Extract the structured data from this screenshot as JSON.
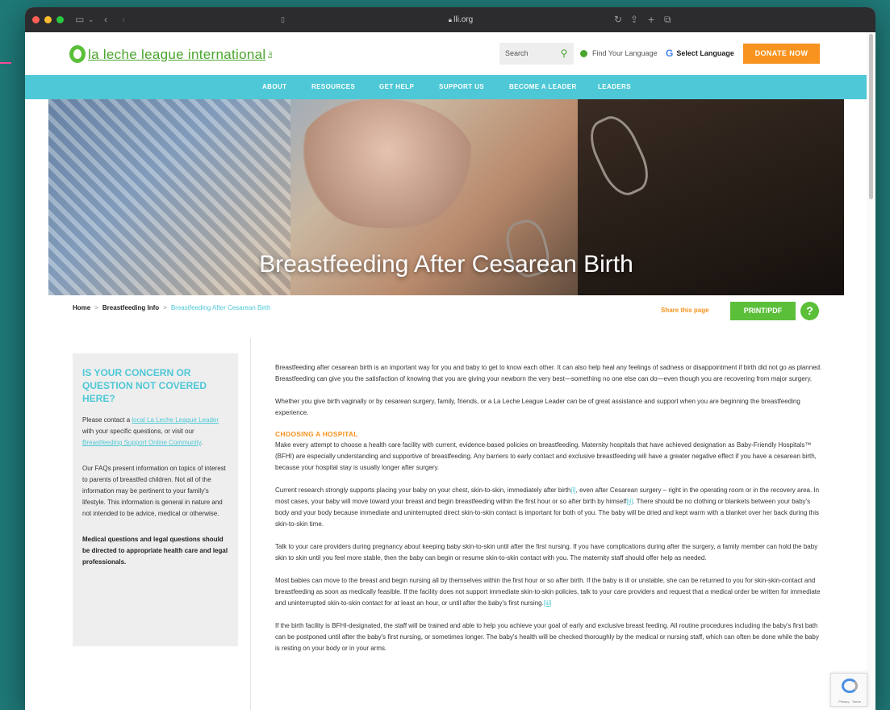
{
  "browser": {
    "url": "lli.org"
  },
  "header": {
    "logo_text": "la leche league international",
    "logo_suffix": ".org",
    "search_placeholder": "Search",
    "find_language": "Find Your Language",
    "select_language": "Select Language",
    "donate": "DONATE NOW"
  },
  "nav": {
    "items": [
      "ABOUT",
      "RESOURCES",
      "GET HELP",
      "SUPPORT US",
      "BECOME A LEADER",
      "LEADERS"
    ]
  },
  "hero": {
    "title": "Breastfeeding After Cesarean Birth"
  },
  "breadcrumb": {
    "home": "Home",
    "sep": ">",
    "section": "Breastfeeding Info",
    "current": "Breastfeeding After Cesarean Birth"
  },
  "actions": {
    "share": "Share this page",
    "print": "PRINT/PDF",
    "help": "?"
  },
  "sidebar": {
    "title": "IS YOUR CONCERN OR QUESTION NOT COVERED HERE?",
    "p1_a": "Please contact a ",
    "p1_link1": "local La Leche League Leader",
    "p1_b": " with your specific questions, or visit our ",
    "p1_link2": "Breastfeeding Support Online Community",
    "p1_c": ".",
    "p2": "Our FAQs present information on topics of interest to parents of breastfed children. Not all of the information may be pertinent to your family's lifestyle. This information is general in nature and not intended to be advice, medical or otherwise.",
    "p3": "Medical questions and legal questions should be directed to appropriate health care and legal professionals."
  },
  "content": {
    "p1": "Breastfeeding after cesarean birth is an important way for you and baby to get to know each other. It can also help heal any feelings of sadness or disappointment if birth did not go as planned. Breastfeeding can give you the satisfaction of knowing that you are giving your newborn the very best—something no one else can do—even though you are recovering from major surgery.",
    "p2": "Whether you give birth vaginally or by cesarean surgery, family, friends, or a La Leche League Leader can be of great assistance and support when you are beginning the breastfeeding experience.",
    "h_hospital": "CHOOSING A HOSPITAL",
    "p3": "Make every attempt to choose a health care facility with current, evidence-based policies on breastfeeding. Maternity hospitals that have achieved designation as Baby-Friendly Hospitals™ (BFHI) are especially understanding and supportive of breastfeeding. Any barriers to early contact and exclusive breastfeeding will have a greater negative effect if you have a cesarean birth, because your hospital stay is usually longer after surgery.",
    "p4_a": "Current research strongly supports placing your baby on your chest, skin-to-skin, immediately after birth",
    "p4_cite1": "[i]",
    "p4_b": ", even after Cesarean surgery – right in the operating room or in the recovery area. In most cases, your baby will move toward your breast and begin breastfeeding within the first hour or so after birth by himself",
    "p4_cite2": "[ii]",
    "p4_c": ". There should be no clothing or blankets between your baby's body and your body because immediate and uninterrupted direct skin-to-skin contact is important for both of you. The baby will be dried and kept warm with a blanket over her back during this skin-to-skin time.",
    "p5": "Talk to your care providers during pregnancy about keeping baby skin-to-skin until after the first nursing. If you have complications during after the surgery, a family member can hold the baby skin to skin until you feel more stable, then the baby can begin or resume skin-to-skin contact with you. The maternity staff should offer help as needed.",
    "p6_a": "Most babies can move to the breast and begin nursing all by themselves within the first hour or so after birth. If the baby is ill or unstable, she can be returned to you for skin-skin-contact and breastfeeding as soon as medically feasible. If the facility does not support immediate skin-to-skin policies, talk to your care providers and request that a medical order be written for immediate and uninterrupted skin-to-skin contact for at least an hour, or until after the baby's first nursing.",
    "p6_cite": "[iii]",
    "p7": "If the birth facility is BFHI-designated, the staff will be trained and able to help you achieve your goal of early and exclusive breast feeding. All routine procedures including the baby's first bath can be postponed until after the baby's first nursing, or sometimes longer. The baby's health will be checked thoroughly by the medical or nursing staff, which can often be done while the baby is resting on your body or in your arms."
  },
  "recaptcha": {
    "label": "Privacy - Terms"
  }
}
